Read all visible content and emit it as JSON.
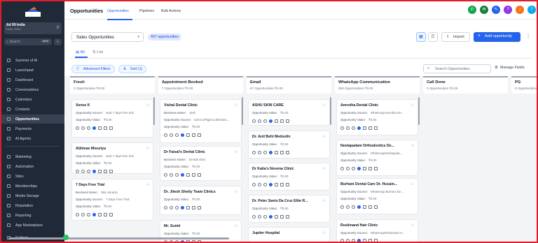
{
  "sidebar": {
    "account_name": "Ad 99 India",
    "account_location": "Delhi, Delhi",
    "search_placeholder": "Search",
    "search_shortcut": "ctrl K",
    "items": [
      {
        "label": "Summer of AI"
      },
      {
        "label": "Launchpad"
      },
      {
        "label": "Dashboard"
      },
      {
        "label": "Conversations"
      },
      {
        "label": "Calendars"
      },
      {
        "label": "Contacts"
      },
      {
        "label": "Opportunities",
        "active": true
      },
      {
        "label": "Payments"
      },
      {
        "label": "AI Agents"
      },
      {
        "label": "Marketing"
      },
      {
        "label": "Automation"
      },
      {
        "label": "Sites"
      },
      {
        "label": "Memberships"
      },
      {
        "label": "Media Storage"
      },
      {
        "label": "Reputation"
      },
      {
        "label": "Reporting"
      },
      {
        "label": "App Marketplace"
      },
      {
        "label": "Settings"
      }
    ]
  },
  "header": {
    "title": "Opportunities",
    "tabs": [
      "Opportunities",
      "Pipelines",
      "Bulk Actions"
    ],
    "icon_colors": [
      "#16a34a",
      "#15803d",
      "#2563eb",
      "#9333ea",
      "#f97316",
      "#0ea5e9",
      "#86efac"
    ],
    "avatar_initials": "SB"
  },
  "toolbar": {
    "pipeline": "Sales Opportunities",
    "count": "407 opportunities",
    "import_label": "Import",
    "add_label": "Add opportunity"
  },
  "subtabs": {
    "all": "All",
    "list": "List"
  },
  "filters": {
    "advanced": "Advanced Filters",
    "sort": "Sort (1)",
    "search_placeholder": "Search Opportunities",
    "manage": "Manage Fields"
  },
  "columns": [
    {
      "title": "Fresh",
      "sub": "3 Opportunities   ₹0.00",
      "cards": [
        {
          "name": "Xenoz K",
          "r1l": "Opportunity Source:",
          "r1v": "start 7 days free trial",
          "r2l": "Opportunity Value:",
          "r2v": "₹0.00"
        },
        {
          "name": "Abhinav Misuriya",
          "r1l": "Opportunity Source:",
          "r1v": "start 7 days free trial",
          "r2l": "Opportunity Value:",
          "r2v": "₹0.00"
        },
        {
          "name": "7 Days Free Trial",
          "r0l": "Business Name:",
          "r0v": "Skin miracle",
          "r1l": "Opportunity Source:",
          "r1v": "7 Days Free Trial",
          "r2l": "Opportunity Value:",
          "r2v": "₹0.00"
        }
      ]
    },
    {
      "title": "Appointment Booked",
      "sub": "7 Opportunities   ₹0.00",
      "cards": [
        {
          "name": "Vishal Dental Clinic",
          "r0l": "Business Name:",
          "r0v": "Jash",
          "r1l": "Opportunity Source:",
          "r1v": "IdzCLwFfgpCLUBGsDo...",
          "r2l": "Opportunity Value:",
          "r2v": "₹0.00"
        },
        {
          "name": "Dr Faisal's Dental Clinic",
          "r0l": "Business Name:",
          "r0v": "Dental clinic",
          "r2l": "Opportunity Value:",
          "r2v": "₹0.00"
        },
        {
          "name": "Dr. Jitesh Shetty Team Clinics",
          "r2l": "Opportunity Value:",
          "r2v": "₹0.00"
        },
        {
          "name": "Mr. Sumit",
          "r2l": "Opportunity Value:",
          "r2v": "₹0.00"
        }
      ]
    },
    {
      "title": "Email",
      "sub": "67 Opportunities   ₹0.00",
      "cards": [
        {
          "name": "ASHU SKIN CARE",
          "r2l": "Opportunity Value:",
          "r2v": "₹0.00"
        },
        {
          "name": "Dr. Anil Behl Medsolin",
          "r2l": "Opportunity Value:",
          "r2v": "₹0.00"
        },
        {
          "name": "Dr Kalia's Novena Clinic",
          "r2l": "Opportunity Value:",
          "r2v": "₹0.00"
        },
        {
          "name": "Dr. Peter Savio Da Cruz Elite R...",
          "r2l": "Opportunity Value:",
          "r2v": "₹0.00"
        },
        {
          "name": "Jupiter Hospital"
        }
      ]
    },
    {
      "title": "WhatsApp Communication",
      "sub": "396 Opportunities   ₹0.00",
      "cards": [
        {
          "name": "Amrutha Dental Clinic",
          "r1l": "Opportunity Source:",
          "r1v": "WhatsAppAmrutha De...",
          "r2l": "Opportunity Value:",
          "r2v": "₹0.00"
        },
        {
          "name": "Neelapadam Orthodontics De...",
          "r1l": "Opportunity Source:",
          "r1v": "WhatsAppNeelapada...",
          "r2l": "Opportunity Value:",
          "r2v": "₹0.00"
        },
        {
          "name": "Burhani Dental Care Dr. Husain...",
          "r1l": "Opportunity Source:",
          "r1v": "WhatsApp Burhani De...",
          "r2l": "Opportunity Value:",
          "r2v": "₹0.00"
        },
        {
          "name": "Rsskinand Hair Clinic",
          "r1l": "Opportunity Source:",
          "r1v": "WhatsAppRsskinand H..."
        }
      ]
    },
    {
      "title": "Call Done",
      "sub": "0 Opportunities   ₹0.00",
      "cards": []
    },
    {
      "title": "PG",
      "sub": "0 Opportunities",
      "cards": []
    }
  ]
}
